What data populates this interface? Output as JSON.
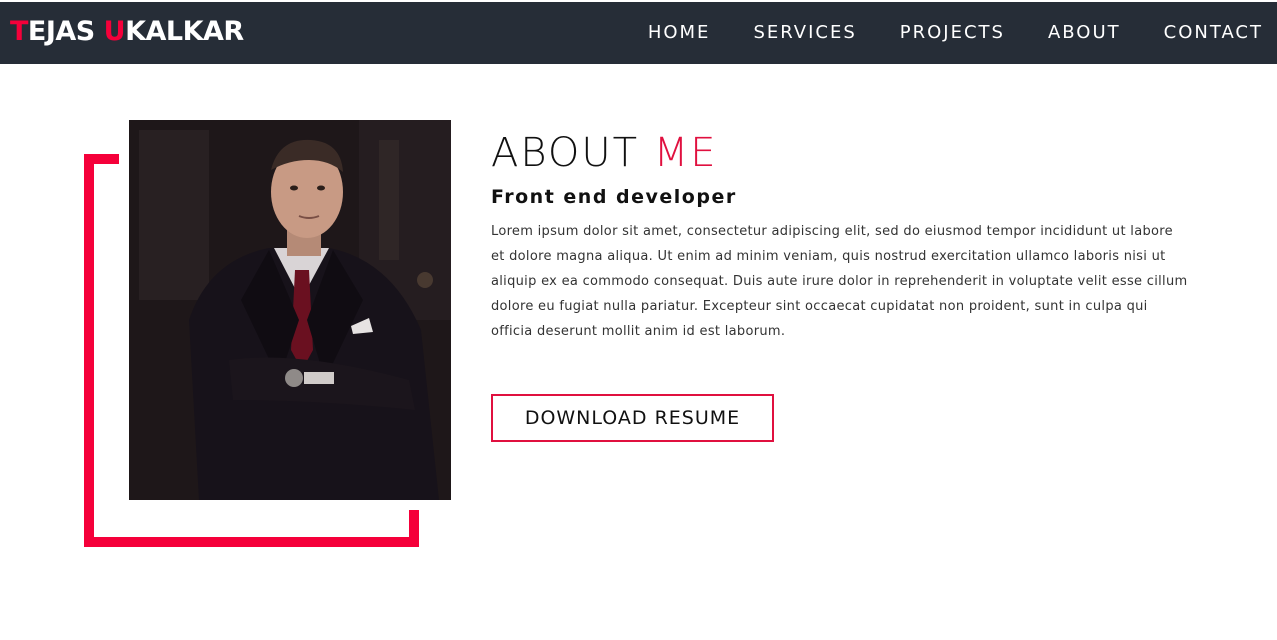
{
  "brand": {
    "first_initial": "T",
    "first_rest": "EJAS ",
    "last_initial": "U",
    "last_rest": "KALKAR",
    "accent_color": "#f5003a"
  },
  "nav": {
    "background": "#262d37",
    "links": [
      "HOME",
      "SERVICES",
      "PROJECTS",
      "ABOUT",
      "CONTACT"
    ]
  },
  "about": {
    "title_main": "ABOUT ",
    "title_accent": "ME",
    "subtitle": "Front end developer",
    "body": "Lorem ipsum dolor sit amet, consectetur adipiscing elit, sed do eiusmod tempor incididunt ut labore et dolore magna aliqua. Ut enim ad minim veniam, quis nostrud exercitation ullamco laboris nisi ut aliquip ex ea commodo consequat. Duis aute irure dolor in reprehenderit in voluptate velit esse cillum dolore eu fugiat nulla pariatur. Excepteur sint occaecat cupidatat non proident, sunt in culpa qui officia deserunt mollit anim id est laborum.",
    "resume_button": "DOWNLOAD RESUME",
    "accent_color": "#e0103f"
  }
}
